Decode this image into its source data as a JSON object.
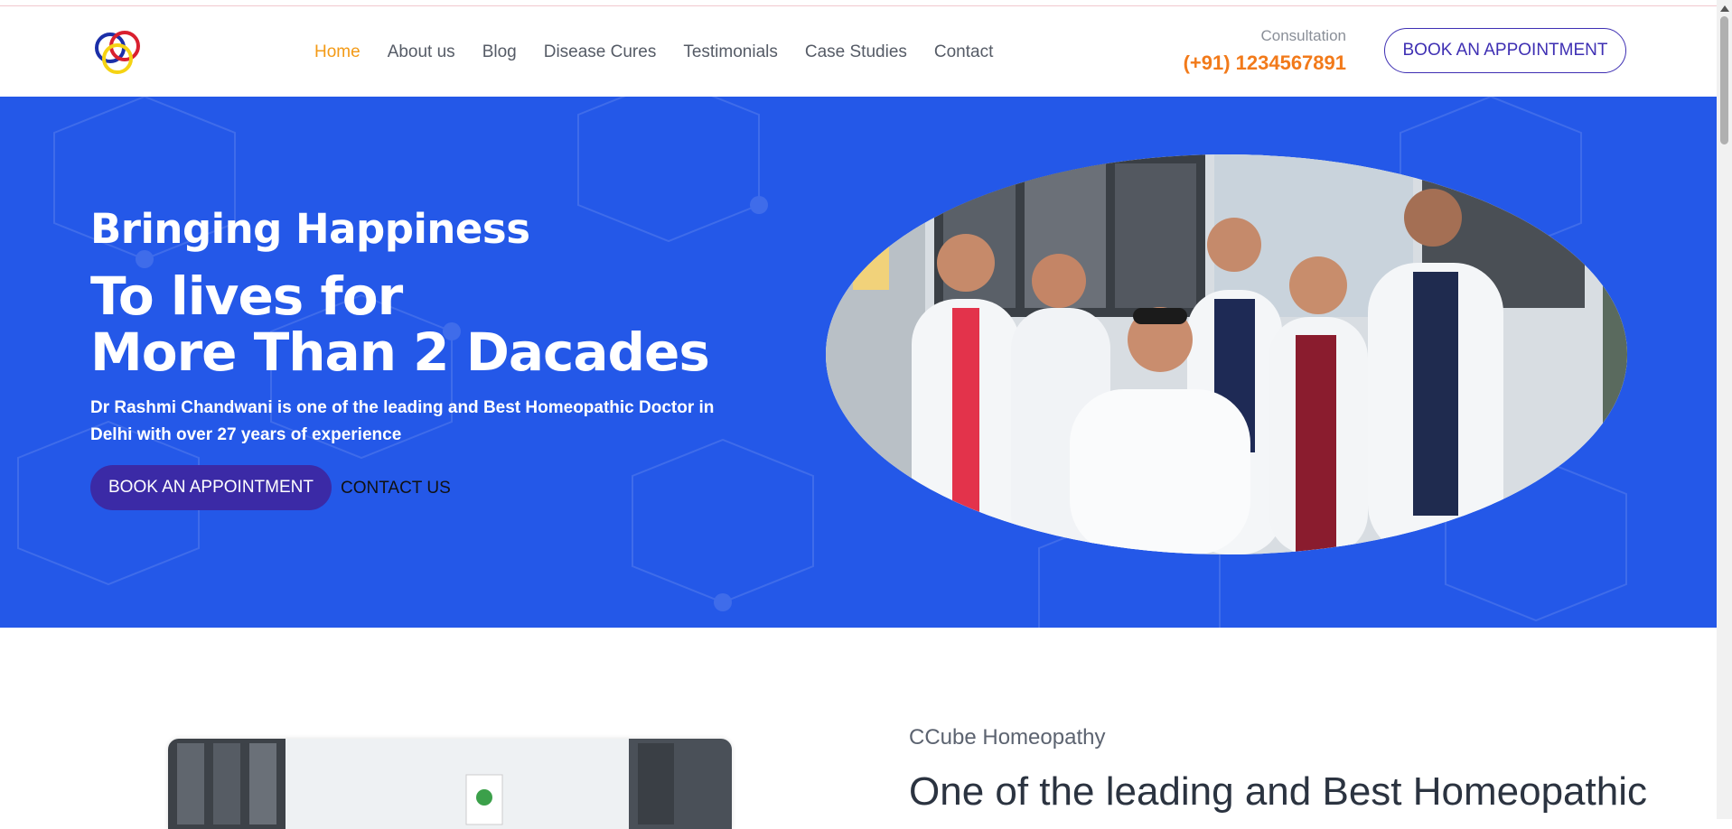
{
  "header": {
    "nav": [
      {
        "label": "Home",
        "active": true
      },
      {
        "label": "About us",
        "active": false
      },
      {
        "label": "Blog",
        "active": false
      },
      {
        "label": "Disease Cures",
        "active": false
      },
      {
        "label": "Testimonials",
        "active": false
      },
      {
        "label": "Case Studies",
        "active": false
      },
      {
        "label": "Contact",
        "active": false
      }
    ],
    "consultation_label": "Consultation",
    "phone": "(+91) 1234567891",
    "book_label": "BOOK AN APPOINTMENT"
  },
  "hero": {
    "heading_small": "Bringing Happiness",
    "heading_line1": "To lives for",
    "heading_line2": "More Than 2 Dacades",
    "description": "Dr Rashmi Chandwani is one of the leading and Best Homeopathic Doctor in Delhi with over 27 years of experience",
    "book_label": "BOOK AN APPOINTMENT",
    "contact_label": "CONTACT US"
  },
  "about": {
    "kicker": "CCube Homeopathy",
    "title": "One of the leading and Best Homeopathic"
  },
  "colors": {
    "accent_orange": "#f39a16",
    "phone_orange": "#f27a1a",
    "hero_blue": "#2458e8",
    "button_purple": "#3b2aa6",
    "outline_purple": "#3e2fb3"
  },
  "icons": [
    "ccube-logo-icon",
    "scroll-up-arrow-icon"
  ]
}
